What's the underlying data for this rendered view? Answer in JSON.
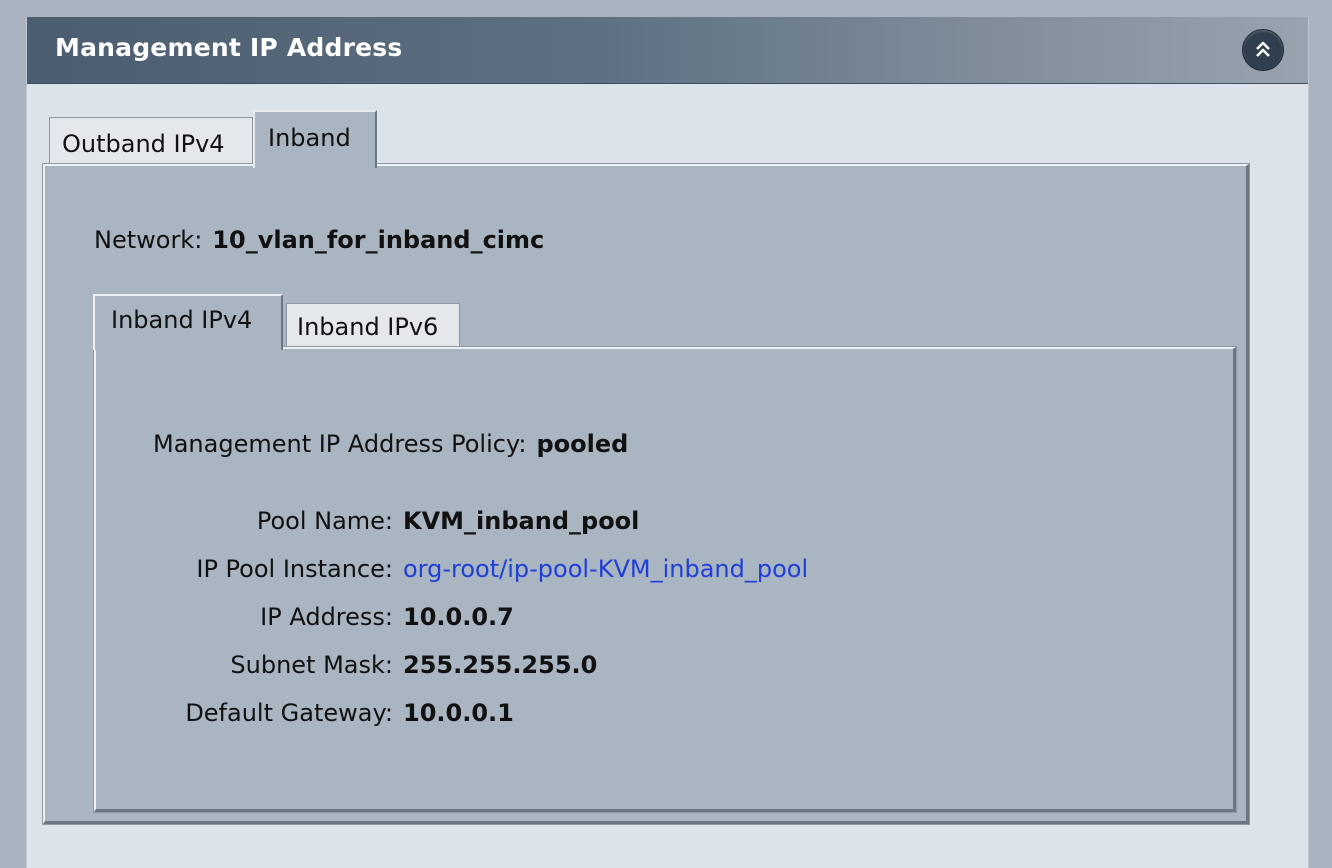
{
  "panel": {
    "title": "Management IP Address",
    "collapse_icon": "double-chevron-up-icon"
  },
  "outer_tabs": [
    {
      "label": "Outband IPv4",
      "selected": false
    },
    {
      "label": "Inband",
      "selected": true
    }
  ],
  "network": {
    "label": "Network:",
    "value": "10_vlan_for_inband_cimc"
  },
  "inner_tabs": [
    {
      "label": "Inband IPv4",
      "selected": true
    },
    {
      "label": "Inband IPv6",
      "selected": false
    }
  ],
  "details": {
    "policy": {
      "label": "Management IP Address Policy:",
      "value": "pooled"
    },
    "pool_name": {
      "label": "Pool Name:",
      "value": "KVM_inband_pool"
    },
    "pool_instance": {
      "label": "IP Pool Instance:",
      "value": "org-root/ip-pool-KVM_inband_pool"
    },
    "ip_address": {
      "label": "IP Address:",
      "value": "10.0.0.7"
    },
    "subnet_mask": {
      "label": "Subnet Mask:",
      "value": "255.255.255.0"
    },
    "default_gateway": {
      "label": "Default Gateway:",
      "value": "10.0.0.1"
    }
  },
  "colors": {
    "header_dark": "#4b5d6f",
    "panel_bg": "#dde3ea",
    "tab_content_bg": "#a9b5c1",
    "link": "#1f3fd8"
  }
}
